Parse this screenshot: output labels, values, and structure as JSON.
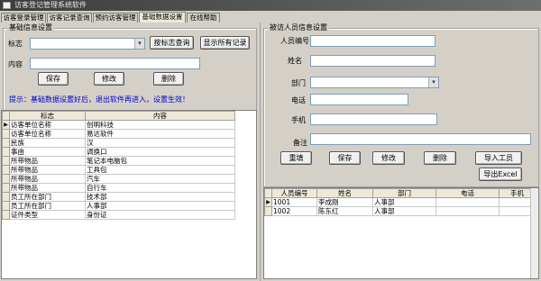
{
  "window": {
    "title": "访客登记管理系统软件"
  },
  "tabs": [
    {
      "label": "访客登录管理",
      "active": false
    },
    {
      "label": "访客记录查询",
      "active": false
    },
    {
      "label": "预约访客管理",
      "active": false
    },
    {
      "label": "基础数据设置",
      "active": true
    },
    {
      "label": "在线帮助",
      "active": false
    }
  ],
  "basic": {
    "group_title": "基础信息设置",
    "sign_label": "标志",
    "sign_value": "",
    "content_label": "内容",
    "content_value": "",
    "query_button": "按标志查询",
    "show_all_button": "显示所有记录",
    "save_button": "保存",
    "modify_button": "修改",
    "delete_button": "删除",
    "tip": "提示：基础数据设置好后，退出软件再进入，设置生效！",
    "table": {
      "headers": [
        "标志",
        "内容"
      ],
      "rows": [
        [
          "访客单位名称",
          "创明科技"
        ],
        [
          "访客单位名称",
          "易达软件"
        ],
        [
          "民族",
          "汉"
        ],
        [
          "事由",
          "调换口"
        ],
        [
          "所带物品",
          "笔记本电脑包"
        ],
        [
          "所带物品",
          "工具包"
        ],
        [
          "所带物品",
          "汽车"
        ],
        [
          "所带物品",
          "自行车"
        ],
        [
          "员工所在部门",
          "技术部"
        ],
        [
          "员工所在部门",
          "人事部"
        ],
        [
          "证件类型",
          "身份证"
        ]
      ]
    }
  },
  "visitee": {
    "group_title": "被访人员信息设置",
    "id_label": "人员编号",
    "id_value": "",
    "name_label": "姓名",
    "name_value": "",
    "dept_label": "部门",
    "dept_value": "",
    "phone_label": "电话",
    "phone_value": "",
    "mobile_label": "手机",
    "mobile_value": "",
    "note_label": "备注",
    "note_value": "",
    "reset_button": "重填",
    "save_button": "保存",
    "modify_button": "修改",
    "delete_button": "删除",
    "import_button": "导入工员",
    "export_button": "导出Excel",
    "table": {
      "headers": [
        "人员编号",
        "姓名",
        "部门",
        "电话",
        "手机"
      ],
      "rows": [
        [
          "1001",
          "李成刚",
          "人事部",
          "",
          ""
        ],
        [
          "1002",
          "陈东红",
          "人事部",
          "",
          ""
        ]
      ]
    }
  },
  "icons": {
    "dropdown": "chevron-down-icon",
    "row_pointer": "row-pointer-icon"
  },
  "colors": {
    "window_bg": "#d4d0c8",
    "tip_text": "#0000cc",
    "title_bar": "#4a4a4a"
  }
}
